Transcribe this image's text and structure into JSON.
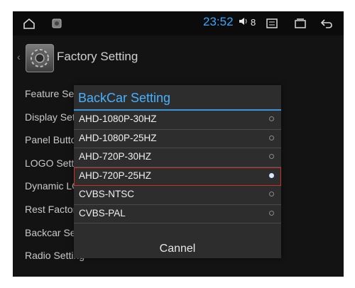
{
  "statusbar": {
    "time": "23:52",
    "volume_level": "8",
    "icons": [
      "home-icon",
      "app-icon",
      "volume-icon",
      "menu-icon",
      "recents-icon",
      "back-icon"
    ]
  },
  "page": {
    "title": "Factory Setting"
  },
  "menu": {
    "items": [
      {
        "label": "Feature Sett"
      },
      {
        "label": "Display Setti"
      },
      {
        "label": "Panel Buttor"
      },
      {
        "label": "LOGO Settin"
      },
      {
        "label": "Dynamic LO("
      },
      {
        "label": "Rest Factory"
      },
      {
        "label": "Backcar Sett"
      },
      {
        "label": "Radio Setting"
      }
    ]
  },
  "dialog": {
    "title": "BackCar Setting",
    "options": [
      {
        "label": "AHD-1080P-30HZ",
        "selected": false
      },
      {
        "label": "AHD-1080P-25HZ",
        "selected": false
      },
      {
        "label": "AHD-720P-30HZ",
        "selected": false
      },
      {
        "label": "AHD-720P-25HZ",
        "selected": true
      },
      {
        "label": "CVBS-NTSC",
        "selected": false
      },
      {
        "label": "CVBS-PAL",
        "selected": false
      }
    ],
    "cancel_label": "Cannel"
  },
  "colors": {
    "accent": "#46b2ff",
    "time": "#3aa6ff",
    "selection_outline": "#c8322c"
  }
}
